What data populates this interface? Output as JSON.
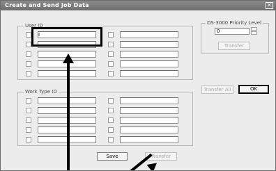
{
  "window": {
    "title": "Create and Send Job Data",
    "close_glyph": "✕"
  },
  "user_id": {
    "label": "User ID",
    "field_count_per_column": 5,
    "first_value": "I"
  },
  "work_type_id": {
    "label": "Work Type ID"
  },
  "priority": {
    "label": "DS-3000 Priority Level",
    "value": "0"
  },
  "buttons": {
    "transfer_priority": "Transfer",
    "transfer_all": "Transfer All",
    "ok": "OK",
    "save": "Save",
    "transfer": "Transfer"
  }
}
